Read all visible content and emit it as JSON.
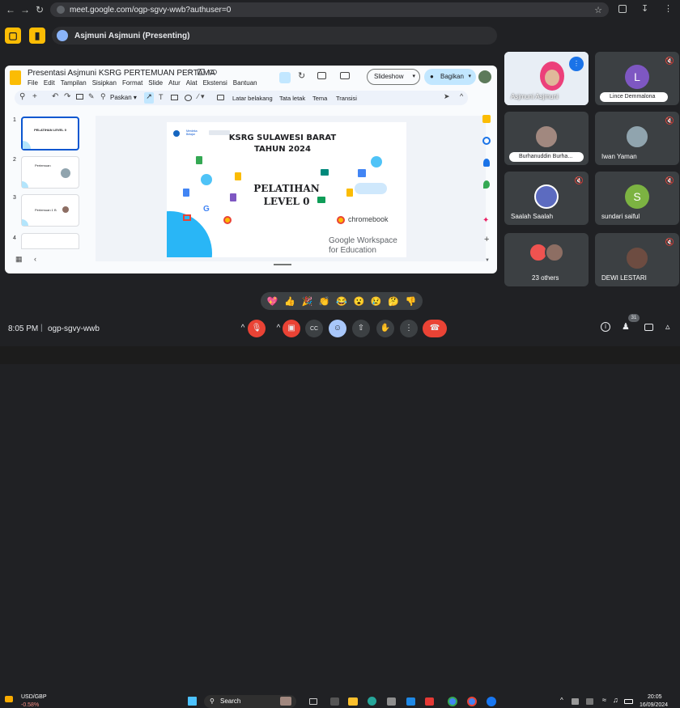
{
  "browser": {
    "url": "meet.google.com/ogp-sgvy-wwb?authuser=0",
    "back": "←",
    "forward": "→",
    "reload": "↻",
    "star": "☆"
  },
  "meet": {
    "presenter_label": "Asjmuni Asjmuni (Presenting)",
    "time": "8:05 PM",
    "separator": "|",
    "meeting_code": "ogp-sgvy-wwb",
    "participant_count": "31",
    "colors": {
      "accent_yellow": "#fbbc04",
      "end_red": "#ea4335",
      "tile_bg": "#3c4043",
      "bg": "#202124"
    }
  },
  "slides_app": {
    "doc_title": "Presentasi Asjmuni KSRG PERTEMUAN PERTAMA",
    "menu": [
      "File",
      "Edit",
      "Tampilan",
      "Sisipkan",
      "Format",
      "Slide",
      "Atur",
      "Alat",
      "Ekstensi",
      "Bantuan"
    ],
    "slideshow_label": "Slideshow",
    "share_label": "Bagikan",
    "toolbar": {
      "fit": "Paskan",
      "background": "Latar belakang",
      "layout": "Tata letak",
      "theme": "Tema",
      "transition": "Transisi"
    },
    "thumb_numbers": [
      "1",
      "2",
      "3",
      "4"
    ],
    "thumb_texts": {
      "t1": "PELATIHAN LEVEL 0",
      "t2": "Pertemuan",
      "t3": "Pertemuan 1 B",
      "t4": ""
    },
    "slide": {
      "title1": "KSRG SULAWESI BARAT",
      "title2": "TAHUN 2024",
      "pel1": "PELATIHAN",
      "pel2": "LEVEL 0",
      "chromebook": "chromebook",
      "gw1": "Google Workspace",
      "gw2": "for Education",
      "logo_small": "Merdeka Belajar"
    }
  },
  "participants": [
    {
      "name": "Asjmuni Asjmuni",
      "type": "video"
    },
    {
      "name": "Lince Demmalona",
      "initial": "L",
      "color": "#7e57c2"
    },
    {
      "name": "Burhanuddin Burha...",
      "type": "photo"
    },
    {
      "name": "Iwan Yaman",
      "type": "photo"
    },
    {
      "name": "Saalah Saalah",
      "type": "photo"
    },
    {
      "name": "sundari saiful",
      "initial": "S",
      "color": "#7cb342"
    },
    {
      "name": "23 others",
      "type": "group"
    },
    {
      "name": "DEWI LESTARI",
      "type": "photo"
    }
  ],
  "reactions": [
    "💖",
    "👍",
    "🎉",
    "👏",
    "😂",
    "😮",
    "😢",
    "🤔",
    "👎"
  ],
  "controls": {
    "chevron": "^",
    "mic": "🎙",
    "cam": "▣",
    "cc": "CC",
    "emoji": "☺",
    "present": "⇧",
    "hand": "✋",
    "more": "⋮",
    "end": "☎"
  },
  "taskbar": {
    "ticker_name": "USD/GBP",
    "ticker_change": "-0.58%",
    "search": "Search",
    "clock_time": "20:05",
    "clock_date": "16/09/2024"
  }
}
